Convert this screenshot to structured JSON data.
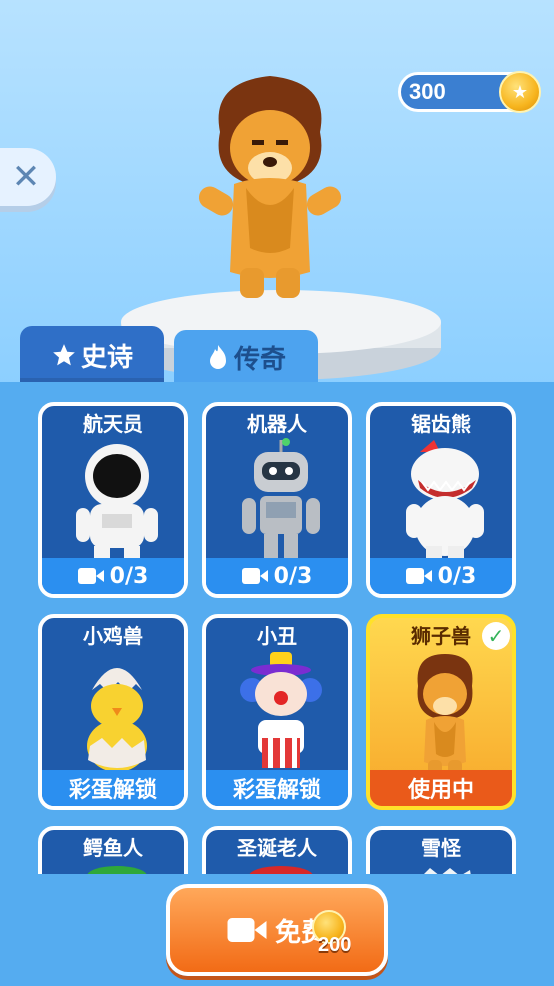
{
  "hud": {
    "coins": "300"
  },
  "tabs": [
    {
      "label": "史诗",
      "icon": "star-icon"
    },
    {
      "label": "传奇",
      "icon": "flame-icon"
    }
  ],
  "cards": [
    {
      "name": "航天员",
      "footer": "0/3",
      "footer_icon": "video-camera-icon",
      "state": "locked"
    },
    {
      "name": "机器人",
      "footer": "0/3",
      "footer_icon": "video-camera-icon",
      "state": "locked"
    },
    {
      "name": "锯齿熊",
      "footer": "0/3",
      "footer_icon": "video-camera-icon",
      "state": "locked"
    },
    {
      "name": "小鸡兽",
      "footer": "彩蛋解锁",
      "state": "egg"
    },
    {
      "name": "小丑",
      "footer": "彩蛋解锁",
      "state": "egg"
    },
    {
      "name": "狮子兽",
      "footer": "使用中",
      "state": "active"
    },
    {
      "name": "鳄鱼人",
      "footer": "",
      "state": "partial"
    },
    {
      "name": "圣诞老人",
      "footer": "",
      "state": "partial"
    },
    {
      "name": "雪怪",
      "footer": "",
      "state": "partial"
    }
  ],
  "free_button": {
    "label": "免费",
    "amount": "200",
    "icon": "video-camera-icon"
  },
  "colors": {
    "accent": "#2b8ff0",
    "active": "#ffd84f",
    "active_footer": "#ea5a1a",
    "button": "#f26b16"
  }
}
